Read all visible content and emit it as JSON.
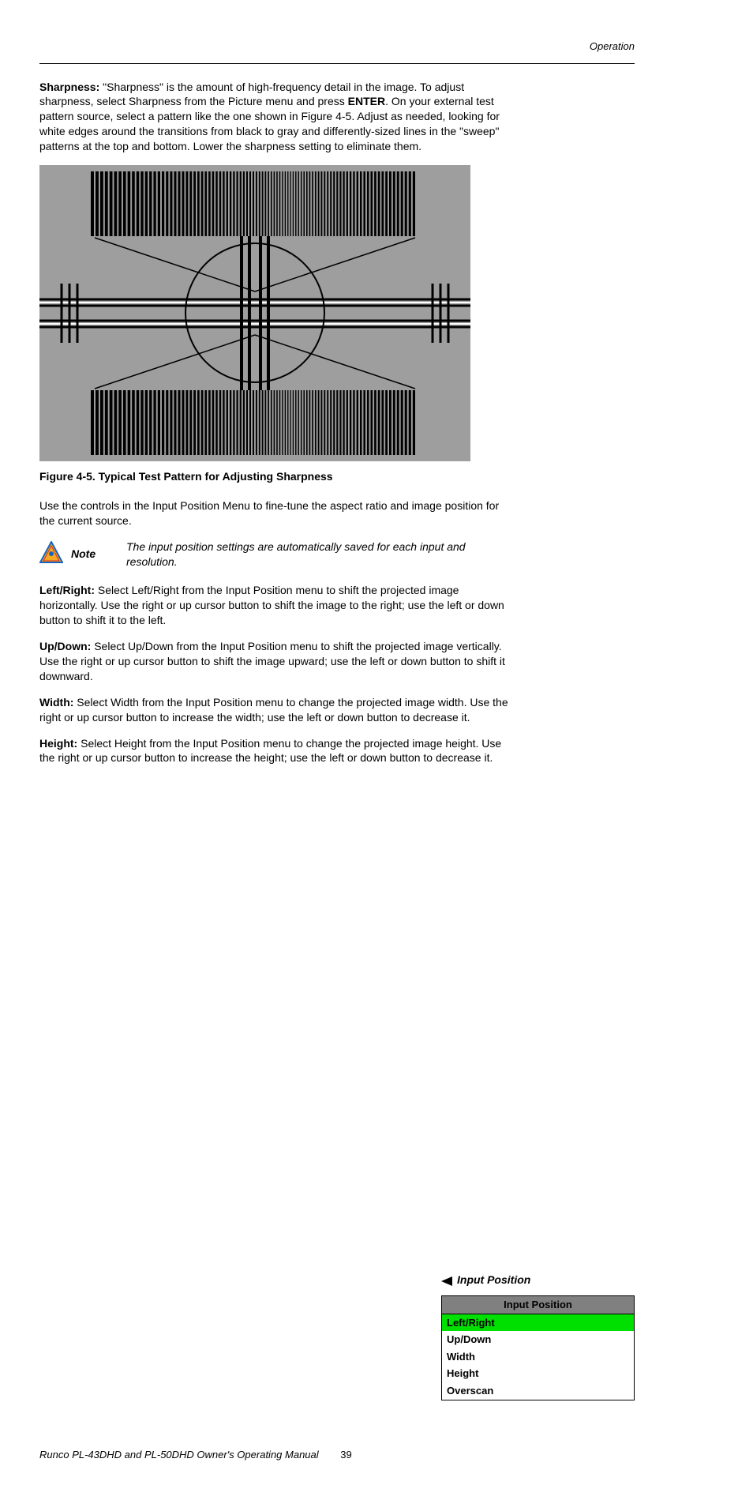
{
  "header": {
    "section": "Operation"
  },
  "sharpness": {
    "title": "Sharpness:",
    "body_before": " \"Sharpness\" is the amount of high-frequency detail in the image. To adjust sharpness, select Sharpness from the Picture menu and press ",
    "enter": "ENTER",
    "body_after": ". On your external test pattern source, select a pattern like the one shown in Figure 4-5. Adjust as needed, looking for white edges around the transitions from black to gray and differently-sized lines in the \"sweep\" patterns at the top and bottom. Lower the sharpness setting to eliminate them."
  },
  "figure_caption": "Figure 4-5. Typical Test Pattern for Adjusting Sharpness",
  "input_position_intro": "Use the controls in the Input Position Menu to fine-tune the aspect ratio and image position for the current source.",
  "side_label": "Input Position",
  "menu": {
    "title": "Input Position",
    "items": [
      "Left/Right",
      "Up/Down",
      "Width",
      "Height",
      "Overscan"
    ],
    "highlight_index": 0
  },
  "note": {
    "label": "Note",
    "text": "The input position settings are automatically saved for each input and resolution."
  },
  "paragraphs": {
    "left_right": {
      "title": "Left/Right:",
      "body": " Select Left/Right from the Input Position menu to shift the projected image horizontally. Use the right or up cursor button to shift the image to the right; use the left or down button to shift it to the left."
    },
    "up_down": {
      "title": "Up/Down:",
      "body": " Select Up/Down from the Input Position menu to shift the projected image vertically. Use the right or up cursor button to shift the image upward; use the left or down button to shift it downward."
    },
    "width": {
      "title": "Width:",
      "body": " Select Width from the Input Position menu to change the projected image width. Use the right or up cursor button to increase the width; use the left or down button to decrease it."
    },
    "height": {
      "title": "Height:",
      "body": " Select Height from the Input Position menu to change the projected image height. Use the right or up cursor button to increase the height; use the left or down button to decrease it."
    }
  },
  "footer": {
    "text": "Runco PL-43DHD and PL-50DHD Owner's Operating Manual",
    "page": "39"
  }
}
